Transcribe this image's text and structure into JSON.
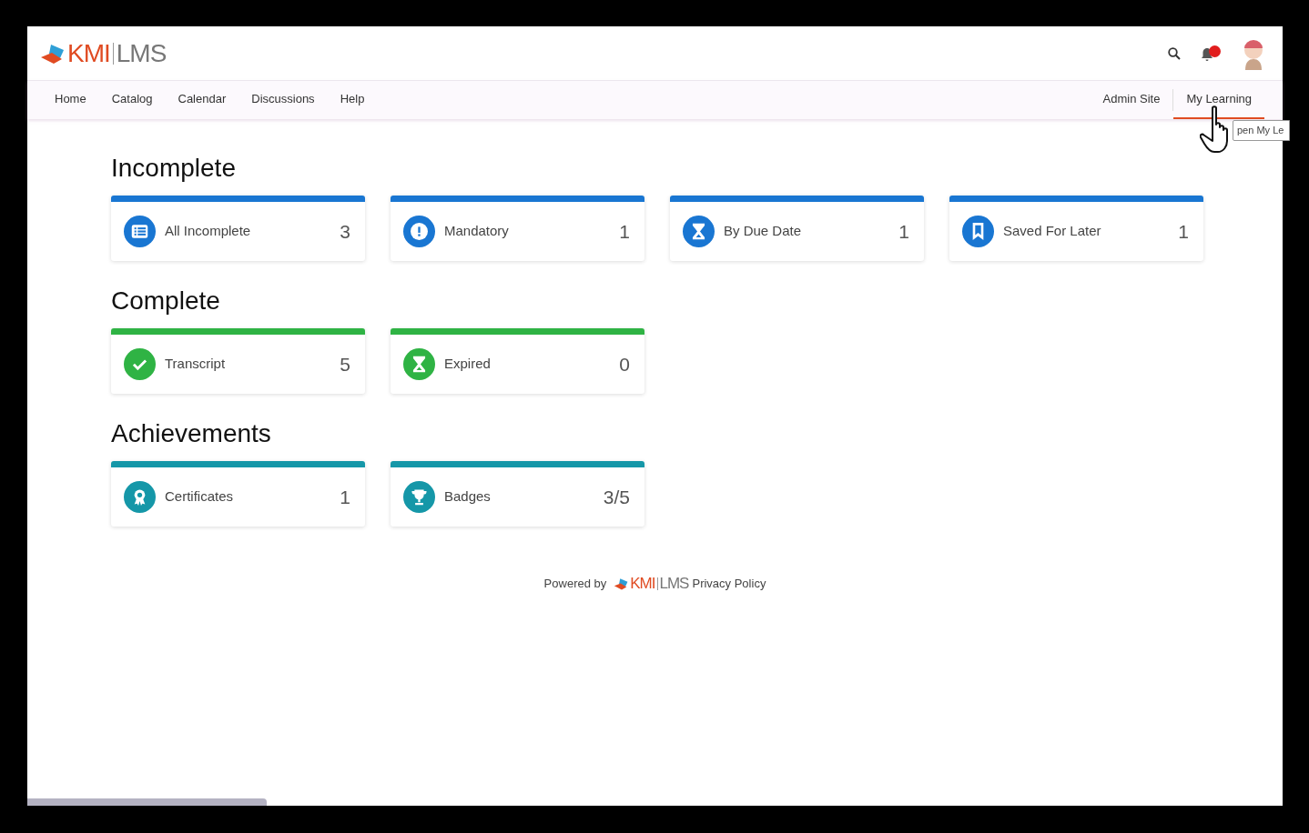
{
  "logo": {
    "brand": "KMI",
    "product": "LMS"
  },
  "header": {
    "notification_dot": true
  },
  "nav": {
    "left": [
      {
        "label": "Home",
        "selected": false
      },
      {
        "label": "Catalog",
        "selected": false
      },
      {
        "label": "Calendar",
        "selected": false
      },
      {
        "label": "Discussions",
        "selected": false
      },
      {
        "label": "Help",
        "selected": false
      }
    ],
    "right": [
      {
        "label": "Admin Site",
        "selected": false
      },
      {
        "label": "My Learning",
        "selected": true
      }
    ]
  },
  "tooltip": "pen My Le",
  "sections": [
    {
      "title": "Incomplete",
      "color": "#1976d2",
      "cards": [
        {
          "kind": "list",
          "label": "All Incomplete",
          "count": "3"
        },
        {
          "kind": "alert",
          "label": "Mandatory",
          "count": "1"
        },
        {
          "kind": "hourglass",
          "label": "By Due Date",
          "count": "1"
        },
        {
          "kind": "bookmark",
          "label": "Saved For Later",
          "count": "1"
        }
      ]
    },
    {
      "title": "Complete",
      "color": "#2fb344",
      "cards": [
        {
          "kind": "check",
          "label": "Transcript",
          "count": "5"
        },
        {
          "kind": "hourglass",
          "label": "Expired",
          "count": "0"
        }
      ]
    },
    {
      "title": "Achievements",
      "color": "#1597a8",
      "cards": [
        {
          "kind": "award",
          "label": "Certificates",
          "count": "1"
        },
        {
          "kind": "trophy",
          "label": "Badges",
          "count": "3/5"
        }
      ]
    }
  ],
  "footer": {
    "powered_by": "Powered by",
    "brand": "KMI",
    "product": "LMS",
    "link": "Privacy Policy"
  }
}
